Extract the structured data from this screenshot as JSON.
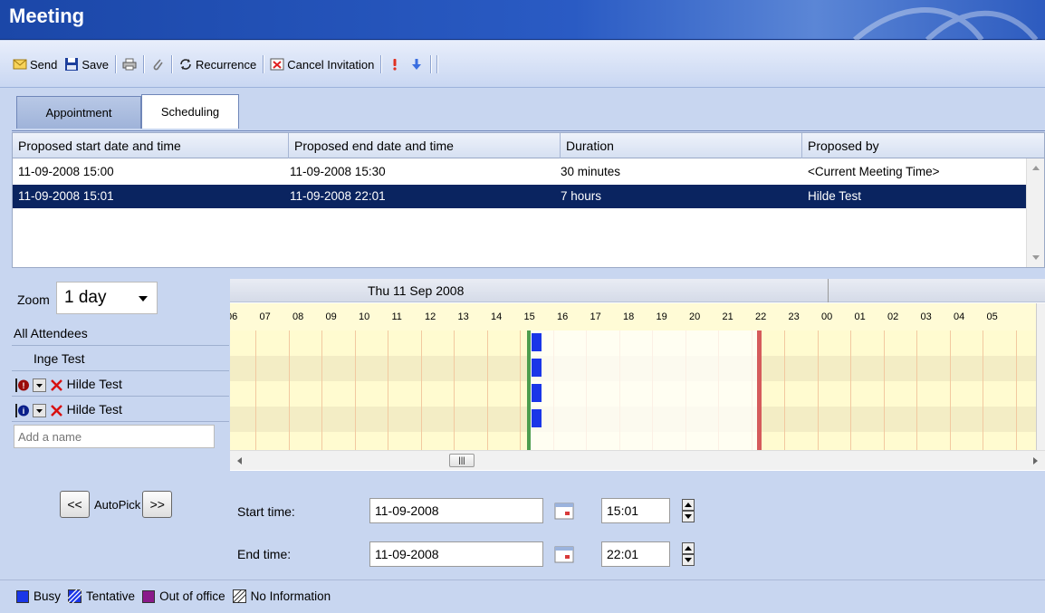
{
  "window": {
    "title": "Meeting"
  },
  "toolbar": {
    "send": "Send",
    "save": "Save",
    "recurrence": "Recurrence",
    "cancel_invitation": "Cancel Invitation"
  },
  "tabs": [
    {
      "label": "Appointment",
      "active": false
    },
    {
      "label": "Scheduling",
      "active": true
    }
  ],
  "proposals": {
    "headers": [
      "Proposed start date and time",
      "Proposed end date and time",
      "Duration",
      "Proposed by"
    ],
    "rows": [
      [
        "11-09-2008 15:00",
        "11-09-2008 15:30",
        "30 minutes",
        "<Current Meeting Time>"
      ],
      [
        "11-09-2008 15:01",
        "11-09-2008 22:01",
        "7 hours",
        "Hilde Test"
      ]
    ],
    "selected_row": 1
  },
  "zoom": {
    "label": "Zoom",
    "value": "1 day"
  },
  "attendees": {
    "all": "All Attendees",
    "list": [
      {
        "name": "Inge Test"
      },
      {
        "name": "Hilde Test",
        "role": "required"
      },
      {
        "name": "Hilde Test",
        "role": "optional"
      }
    ],
    "add_placeholder": "Add a name"
  },
  "schedule": {
    "date": "Thu 11 Sep 2008",
    "hours": [
      "06",
      "07",
      "08",
      "09",
      "10",
      "11",
      "12",
      "13",
      "14",
      "15",
      "16",
      "17",
      "18",
      "19",
      "20",
      "21",
      "22",
      "23",
      "00",
      "01",
      "02",
      "03",
      "04",
      "05"
    ],
    "meeting_start": "15:01",
    "meeting_end": "22:01"
  },
  "autopick": {
    "prev": "<<",
    "label": "AutoPick",
    "next": ">>"
  },
  "times": {
    "start_label": "Start time:",
    "start_date": "11-09-2008",
    "start_time": "15:01",
    "end_label": "End time:",
    "end_date": "11-09-2008",
    "end_time": "22:01"
  },
  "legend": [
    {
      "label": "Busy",
      "color": "#1a36e8"
    },
    {
      "label": "Tentative",
      "color": "#1a36e8"
    },
    {
      "label": "Out of office",
      "color": "#8a1a8a"
    },
    {
      "label": "No Information",
      "color": "#ffffff"
    }
  ]
}
